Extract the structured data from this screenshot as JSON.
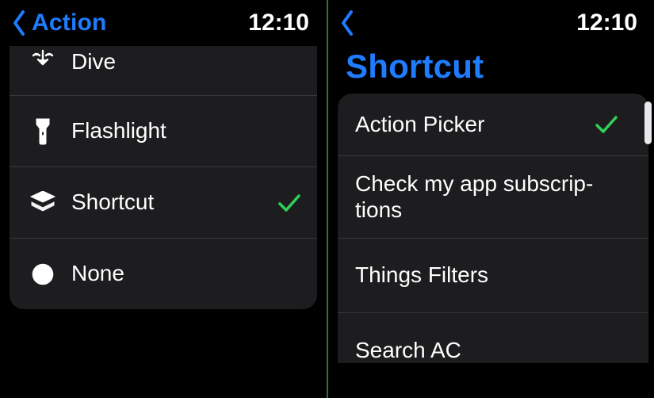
{
  "left": {
    "back_label": "Action",
    "time": "12:10",
    "rows": [
      {
        "icon": "dive-icon",
        "label": "Dive",
        "selected": false
      },
      {
        "icon": "flashlight-icon",
        "label": "Flashlight",
        "selected": false
      },
      {
        "icon": "shortcut-icon",
        "label": "Shortcut",
        "selected": true
      },
      {
        "icon": "none-icon",
        "label": "None",
        "selected": false
      }
    ]
  },
  "right": {
    "time": "12:10",
    "title": "Shortcut",
    "rows": [
      {
        "label": "Action Picker",
        "selected": true
      },
      {
        "label": "Check my app subscrip­tions",
        "selected": false
      },
      {
        "label": "Things Filters",
        "selected": false
      },
      {
        "label": "Search AC",
        "selected": false
      }
    ]
  }
}
